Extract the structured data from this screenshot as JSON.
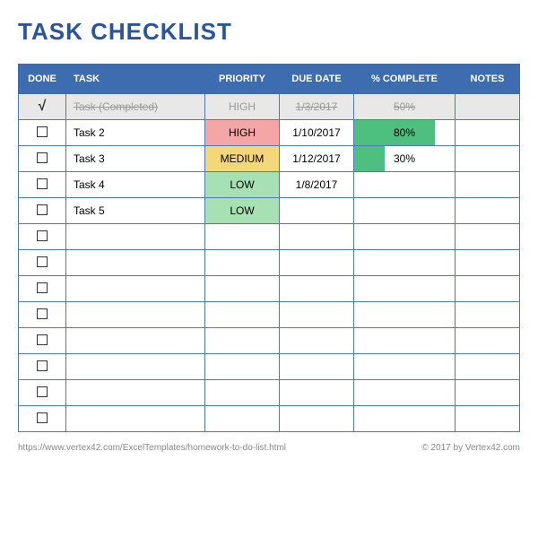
{
  "title": "TASK CHECKLIST",
  "headers": {
    "done": "DONE",
    "task": "TASK",
    "priority": "PRIORITY",
    "duedate": "DUE DATE",
    "complete": "% COMPLETE",
    "notes": "NOTES"
  },
  "rows": [
    {
      "done": true,
      "task": "Task (Completed)",
      "priority": "HIGH",
      "priority_class": "",
      "duedate": "1/3/2017",
      "complete": 50,
      "notes": "",
      "completed": true
    },
    {
      "done": false,
      "task": "Task 2",
      "priority": "HIGH",
      "priority_class": "priority-high",
      "duedate": "1/10/2017",
      "complete": 80,
      "notes": "",
      "completed": false
    },
    {
      "done": false,
      "task": "Task 3",
      "priority": "MEDIUM",
      "priority_class": "priority-medium",
      "duedate": "1/12/2017",
      "complete": 30,
      "notes": "",
      "completed": false
    },
    {
      "done": false,
      "task": "Task 4",
      "priority": "LOW",
      "priority_class": "priority-low",
      "duedate": "1/8/2017",
      "complete": null,
      "notes": "",
      "completed": false
    },
    {
      "done": false,
      "task": "Task 5",
      "priority": "LOW",
      "priority_class": "priority-low",
      "duedate": "",
      "complete": null,
      "notes": "",
      "completed": false
    },
    {
      "done": false,
      "task": "",
      "priority": "",
      "priority_class": "",
      "duedate": "",
      "complete": null,
      "notes": "",
      "completed": false
    },
    {
      "done": false,
      "task": "",
      "priority": "",
      "priority_class": "",
      "duedate": "",
      "complete": null,
      "notes": "",
      "completed": false
    },
    {
      "done": false,
      "task": "",
      "priority": "",
      "priority_class": "",
      "duedate": "",
      "complete": null,
      "notes": "",
      "completed": false
    },
    {
      "done": false,
      "task": "",
      "priority": "",
      "priority_class": "",
      "duedate": "",
      "complete": null,
      "notes": "",
      "completed": false
    },
    {
      "done": false,
      "task": "",
      "priority": "",
      "priority_class": "",
      "duedate": "",
      "complete": null,
      "notes": "",
      "completed": false
    },
    {
      "done": false,
      "task": "",
      "priority": "",
      "priority_class": "",
      "duedate": "",
      "complete": null,
      "notes": "",
      "completed": false
    },
    {
      "done": false,
      "task": "",
      "priority": "",
      "priority_class": "",
      "duedate": "",
      "complete": null,
      "notes": "",
      "completed": false
    },
    {
      "done": false,
      "task": "",
      "priority": "",
      "priority_class": "",
      "duedate": "",
      "complete": null,
      "notes": "",
      "completed": false
    }
  ],
  "footer": {
    "url": "https://www.vertex42.com/ExcelTemplates/homework-to-do-list.html",
    "copyright": "© 2017 by Vertex42.com"
  }
}
